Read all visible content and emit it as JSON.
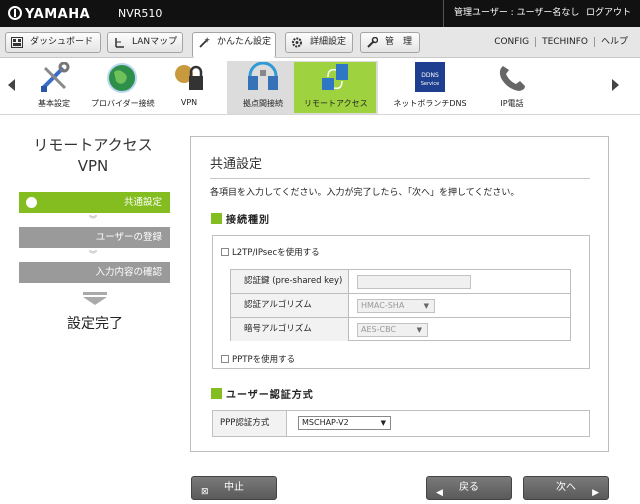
{
  "topbar": {
    "logo": "YAMAHA",
    "model": "NVR510",
    "user": "管理ユーザー : ユーザー名なし",
    "logout": "ログアウト"
  },
  "tabs": [
    {
      "label": "ダッシュボード",
      "icon": "dashboard-icon"
    },
    {
      "label": "LANマップ",
      "icon": "lanmap-icon"
    },
    {
      "label": "かんたん設定",
      "icon": "wand-icon",
      "active": true
    },
    {
      "label": "詳細設定",
      "icon": "gear-icon"
    },
    {
      "label": "管　理",
      "icon": "wrench-icon"
    }
  ],
  "header_links": [
    "CONFIG",
    "TECHINFO",
    "ヘルプ"
  ],
  "icon_nav": [
    {
      "label": "基本設定",
      "icon": "tools-icon"
    },
    {
      "label": "プロバイダー接続",
      "icon": "globe-icon"
    },
    {
      "label": "VPN",
      "icon": "vpn-lock-icon"
    },
    {
      "label": "拠点間接続",
      "icon": "site-to-site-icon"
    },
    {
      "label": "リモートアクセス",
      "icon": "remote-access-icon",
      "selected": true
    },
    {
      "label": "ネットボランチDNS",
      "icon": "dns-service-icon",
      "badge": "DDNS Service"
    },
    {
      "label": "IP電話",
      "icon": "phone-icon"
    }
  ],
  "wizard": {
    "title_line1": "リモートアクセス",
    "title_line2": "VPN",
    "steps": [
      {
        "label": "共通設定",
        "state": "active"
      },
      {
        "label": "ユーザーの登録",
        "state": "inactive"
      },
      {
        "label": "入力内容の確認",
        "state": "inactive"
      }
    ],
    "done_label": "設定完了"
  },
  "panel": {
    "title": "共通設定",
    "description": "各項目を入力してください。入力が完了したら、「次へ」を押してください。",
    "section1": {
      "title": "接続種別",
      "l2tp_label": "L2TP/IPsecを使用する",
      "l2tp_checked": false,
      "rows": [
        {
          "key": "認証鍵 (pre-shared key)",
          "value": ""
        },
        {
          "key": "認証アルゴリズム",
          "value": "HMAC-SHA"
        },
        {
          "key": "暗号アルゴリズム",
          "value": "AES-CBC"
        }
      ],
      "pptp_label": "PPTPを使用する",
      "pptp_checked": false
    },
    "section2": {
      "title": "ユーザー認証方式",
      "key": "PPP認証方式",
      "value": "MSCHAP-V2"
    }
  },
  "buttons": {
    "cancel": "中止",
    "back": "戻る",
    "next": "次へ"
  },
  "colors": {
    "accent_green": "#84bd1f",
    "selected_green": "#9ed23f",
    "inactive_gray": "#9a9a9a",
    "topbar_black": "#111111"
  }
}
